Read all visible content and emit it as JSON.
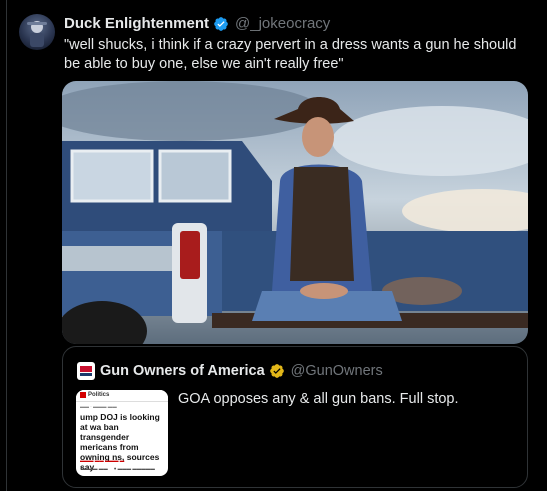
{
  "tweet": {
    "author_name": "Duck Enlightenment",
    "author_handle": "@_jokeocracy",
    "text": "\"well shucks, i think if a crazy pervert in a dress wants a gun he should be able to buy one, else we ain't really free\"",
    "avatar_icon": "avatar-image",
    "verified_color": "#1d9bf0"
  },
  "quote": {
    "author_name": "Gun Owners of America",
    "author_handle": "@GunOwners",
    "text": "GOA opposes any & all gun bans. Full stop.",
    "verified_color": "#e2b719",
    "thumbnail": {
      "source": "Politics",
      "headline": "ump DOJ is looking at wa ban transgender mericans from owning ns, sources say"
    }
  }
}
